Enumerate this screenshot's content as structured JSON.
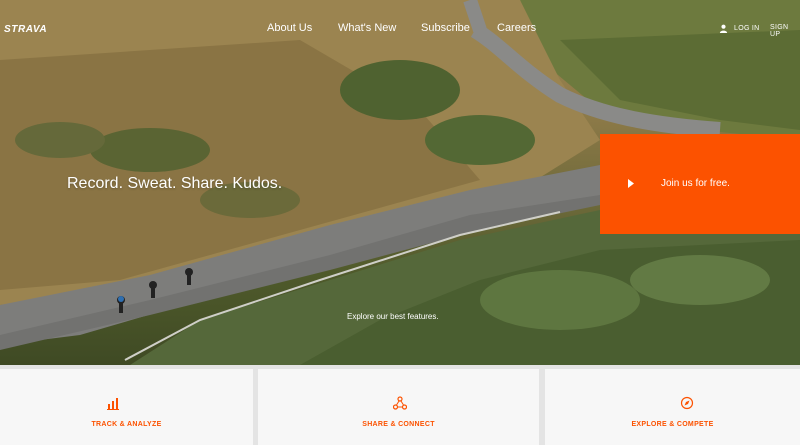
{
  "brand": {
    "logo_text": "STRAVA",
    "accent_color": "#fc5200"
  },
  "nav": {
    "links": [
      "About Us",
      "What's New",
      "Subscribe",
      "Careers"
    ],
    "login_label": "LOG IN",
    "signup_label": "SIGN UP",
    "login_icon": "user-icon"
  },
  "hero": {
    "tagline": "Record. Sweat. Share. Kudos.",
    "cta_label": "Join us for free.",
    "cta_icon": "play-icon",
    "explore_text": "Explore our best features."
  },
  "features": [
    {
      "label": "TRACK & ANALYZE",
      "icon": "chart-icon"
    },
    {
      "label": "SHARE & CONNECT",
      "icon": "share-network-icon"
    },
    {
      "label": "EXPLORE & COMPETE",
      "icon": "compass-icon"
    }
  ]
}
